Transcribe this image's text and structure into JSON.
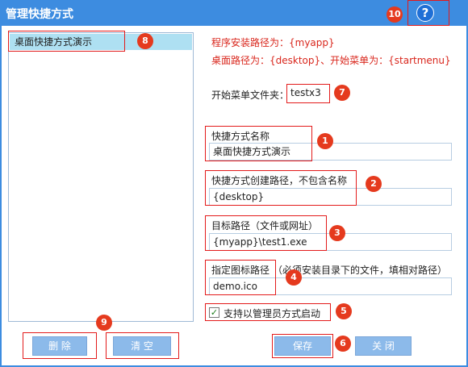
{
  "window": {
    "title": "管理快捷方式",
    "help_glyph": "?"
  },
  "shortcut_list": {
    "items": [
      "桌面快捷方式演示"
    ]
  },
  "info": {
    "line1": "程序安装路径为：{myapp}",
    "line2": "桌面路径为：{desktop}、开始菜单为：{startmenu}"
  },
  "start_menu": {
    "label": "开始菜单文件夹：",
    "value": "testx3"
  },
  "fields": {
    "name": {
      "label": "快捷方式名称",
      "value": "桌面快捷方式演示"
    },
    "create_path": {
      "label": "快捷方式创建路径，不包含名称",
      "value": "{desktop}"
    },
    "target": {
      "label": "目标路径（文件或网址）",
      "value": "{myapp}\\test1.exe"
    },
    "icon": {
      "label": "指定图标路径",
      "hint": "（必须安装目录下的文件，填相对路径）",
      "value": "demo.ico"
    }
  },
  "admin_checkbox": {
    "label": "支持以管理员方式启动",
    "checked": true,
    "glyph": "✓"
  },
  "buttons": {
    "delete": "删 除",
    "clear": "清 空",
    "save": "保存",
    "close": "关 闭"
  },
  "badges": [
    "1",
    "2",
    "3",
    "4",
    "5",
    "6",
    "7",
    "8",
    "9",
    "10"
  ],
  "colors": {
    "title_bar": "#3d8ce0",
    "button": "#8cbaea",
    "info_text": "#d9261c",
    "badge": "#e53a1e",
    "selected_row": "#aee0f2"
  }
}
